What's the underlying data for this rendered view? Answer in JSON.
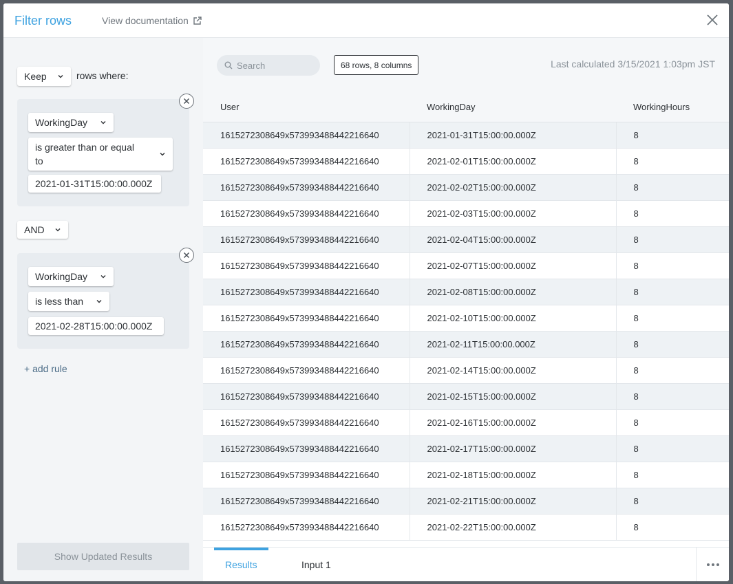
{
  "header": {
    "title": "Filter rows",
    "doc_link": "View documentation"
  },
  "filter": {
    "keep_select": "Keep",
    "rows_where": "rows where:",
    "rules": [
      {
        "column": "WorkingDay",
        "operator_line1": "is greater than or equal",
        "operator_line2": "to",
        "value": "2021-01-31T15:00:00.000Z"
      },
      {
        "column": "WorkingDay",
        "operator": "is less than",
        "value": "2021-02-28T15:00:00.000Z"
      }
    ],
    "conjunction": "AND",
    "add_rule": "+ add rule",
    "show_button": "Show Updated Results"
  },
  "results": {
    "search_placeholder": "Search",
    "rows_badge": "68 rows, 8 columns",
    "last_calculated": "Last calculated 3/15/2021 1:03pm JST",
    "columns": [
      "User",
      "WorkingDay",
      "WorkingHours"
    ],
    "rows": [
      [
        "1615272308649x573993488442216640",
        "2021-01-31T15:00:00.000Z",
        "8"
      ],
      [
        "1615272308649x573993488442216640",
        "2021-02-01T15:00:00.000Z",
        "8"
      ],
      [
        "1615272308649x573993488442216640",
        "2021-02-02T15:00:00.000Z",
        "8"
      ],
      [
        "1615272308649x573993488442216640",
        "2021-02-03T15:00:00.000Z",
        "8"
      ],
      [
        "1615272308649x573993488442216640",
        "2021-02-04T15:00:00.000Z",
        "8"
      ],
      [
        "1615272308649x573993488442216640",
        "2021-02-07T15:00:00.000Z",
        "8"
      ],
      [
        "1615272308649x573993488442216640",
        "2021-02-08T15:00:00.000Z",
        "8"
      ],
      [
        "1615272308649x573993488442216640",
        "2021-02-10T15:00:00.000Z",
        "8"
      ],
      [
        "1615272308649x573993488442216640",
        "2021-02-11T15:00:00.000Z",
        "8"
      ],
      [
        "1615272308649x573993488442216640",
        "2021-02-14T15:00:00.000Z",
        "8"
      ],
      [
        "1615272308649x573993488442216640",
        "2021-02-15T15:00:00.000Z",
        "8"
      ],
      [
        "1615272308649x573993488442216640",
        "2021-02-16T15:00:00.000Z",
        "8"
      ],
      [
        "1615272308649x573993488442216640",
        "2021-02-17T15:00:00.000Z",
        "8"
      ],
      [
        "1615272308649x573993488442216640",
        "2021-02-18T15:00:00.000Z",
        "8"
      ],
      [
        "1615272308649x573993488442216640",
        "2021-02-21T15:00:00.000Z",
        "8"
      ],
      [
        "1615272308649x573993488442216640",
        "2021-02-22T15:00:00.000Z",
        "8"
      ]
    ],
    "tabs": [
      "Results",
      "Input 1"
    ]
  },
  "colors": {
    "accent": "#3ea2e0",
    "panel": "#f3f5f7",
    "rule_card": "#e8ecf0"
  }
}
